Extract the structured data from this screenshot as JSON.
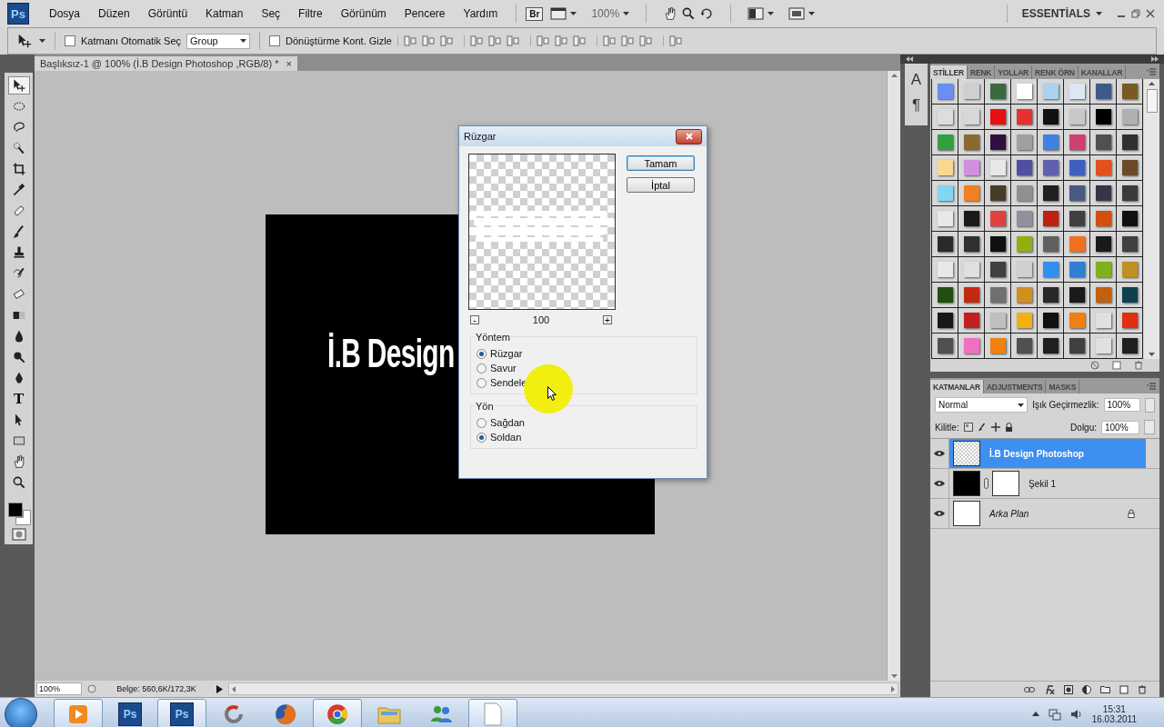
{
  "app": {
    "logo": "Ps",
    "menus": [
      "Dosya",
      "Düzen",
      "Görüntü",
      "Katman",
      "Seç",
      "Filtre",
      "Görünüm",
      "Pencere",
      "Yardım"
    ],
    "bridge": "Br",
    "zoom": "100%",
    "workspace": "ESSENTİALS"
  },
  "options": {
    "auto_select": {
      "label": "Katmanı Otomatik Seç",
      "checked": false
    },
    "auto_select_target": "Group",
    "transform_controls": {
      "label": "Dönüştürme Kont. Gizle",
      "checked": false
    }
  },
  "document": {
    "tab_title": "Başlıksız-1 @ 100% (İ.B Design Photoshop ,RGB/8) *",
    "close": "×",
    "canvas_text": "İ.B Design",
    "zoom": "100%",
    "doc_info": "Belge: 560,6K/172,3K"
  },
  "tools": [
    {
      "kind": "move",
      "selected": true
    },
    {
      "kind": "marquee",
      "selected": false
    },
    {
      "kind": "lasso",
      "selected": false
    },
    {
      "kind": "quick-select",
      "selected": false
    },
    {
      "kind": "crop",
      "selected": false
    },
    {
      "kind": "eyedropper",
      "selected": false
    },
    {
      "kind": "heal",
      "selected": false
    },
    {
      "kind": "brush",
      "selected": false
    },
    {
      "kind": "stamp",
      "selected": false
    },
    {
      "kind": "history-brush",
      "selected": false
    },
    {
      "kind": "eraser",
      "selected": false
    },
    {
      "kind": "gradient",
      "selected": false
    },
    {
      "kind": "blur",
      "selected": false
    },
    {
      "kind": "dodge",
      "selected": false
    },
    {
      "kind": "pen",
      "selected": false
    },
    {
      "kind": "type",
      "glyph": "T",
      "selected": false
    },
    {
      "kind": "path-select",
      "selected": false
    },
    {
      "kind": "shape",
      "selected": false
    },
    {
      "kind": "hand",
      "selected": false
    },
    {
      "kind": "zoom",
      "selected": false
    }
  ],
  "colors": {
    "foreground": {
      "color": "#000000"
    },
    "background": {
      "color": "#ffffff"
    }
  },
  "dialog": {
    "title": "Rüzgar",
    "zoom_out": "-",
    "preview_zoom": "100",
    "zoom_in": "+",
    "buttons": [
      {
        "label": "Tamam",
        "default": true
      },
      {
        "label": "İptal",
        "default": false
      }
    ],
    "groups": [
      {
        "title": "Yöntem",
        "options": [
          {
            "label": "Rüzgar",
            "selected": true
          },
          {
            "label": "Savur",
            "selected": false
          },
          {
            "label": "Sendele",
            "selected": false
          }
        ]
      },
      {
        "title": "Yön",
        "options": [
          {
            "label": "Sağdan",
            "selected": false
          },
          {
            "label": "Soldan",
            "selected": true
          }
        ]
      }
    ]
  },
  "dock": {
    "icons": [
      "A",
      "¶"
    ]
  },
  "styles_panel": {
    "tabs": [
      {
        "label": "STİLLER",
        "selected": true
      },
      {
        "label": "RENK",
        "selected": false
      },
      {
        "label": "YOLLAR",
        "selected": false
      },
      {
        "label": "RENK ÖRN",
        "selected": false
      },
      {
        "label": "KANALLAR",
        "selected": false
      }
    ],
    "rows": [
      {
        "swatches": [
          {
            "color": "#6b8ff0"
          },
          {
            "color": "#cfcfcf"
          },
          {
            "color": "#3a6a40"
          },
          {
            "color": "#ffffff"
          },
          {
            "color": "#a9d3f0"
          },
          {
            "color": "#dbe7f3"
          },
          {
            "color": "#3f5a88"
          },
          {
            "color": "#7a5a20"
          }
        ]
      },
      {
        "swatches": [
          {
            "color": "#dddddd"
          },
          {
            "color": "#d8d8d8"
          },
          {
            "color": "#e81010"
          },
          {
            "color": "#e83030"
          },
          {
            "color": "#111111"
          },
          {
            "color": "#c8c8c8"
          },
          {
            "color": "#000000"
          },
          {
            "color": "#b0b0b0"
          }
        ]
      },
      {
        "swatches": [
          {
            "color": "#30a040"
          },
          {
            "color": "#8a6a30"
          },
          {
            "color": "#301040"
          },
          {
            "color": "#a0a0a0"
          },
          {
            "color": "#4080e0"
          },
          {
            "color": "#d04070"
          },
          {
            "color": "#505050"
          },
          {
            "color": "#303030"
          }
        ]
      },
      {
        "swatches": [
          {
            "color": "#f8d890"
          },
          {
            "color": "#d090e0"
          },
          {
            "color": "#e8e8e8"
          },
          {
            "color": "#5050a0"
          },
          {
            "color": "#6060b0"
          },
          {
            "color": "#4060c0"
          },
          {
            "color": "#e05020"
          },
          {
            "color": "#6a4a2a"
          }
        ]
      },
      {
        "swatches": [
          {
            "color": "#80d8f0"
          },
          {
            "color": "#f08020"
          },
          {
            "color": "#4a3a2a"
          },
          {
            "color": "#909090"
          },
          {
            "color": "#202020"
          },
          {
            "color": "#4a5a80"
          },
          {
            "color": "#353545"
          },
          {
            "color": "#3a3a3a"
          }
        ]
      },
      {
        "swatches": [
          {
            "color": "#e8e8e8"
          },
          {
            "color": "#1a1a1a"
          },
          {
            "color": "#e04040"
          },
          {
            "color": "#9090a0"
          },
          {
            "color": "#c02010"
          },
          {
            "color": "#404040"
          },
          {
            "color": "#d05010"
          },
          {
            "color": "#101010"
          }
        ]
      },
      {
        "swatches": [
          {
            "color": "#2a2a2a"
          },
          {
            "color": "#303030"
          },
          {
            "color": "#101010"
          },
          {
            "color": "#90b010"
          },
          {
            "color": "#606060"
          },
          {
            "color": "#f07020"
          },
          {
            "color": "#1a1a1a"
          },
          {
            "color": "#404040"
          }
        ]
      },
      {
        "swatches": [
          {
            "color": "#e8e8e8"
          },
          {
            "color": "#e0e0e0"
          },
          {
            "color": "#404040"
          },
          {
            "color": "#d0d0d0"
          },
          {
            "color": "#3090f0"
          },
          {
            "color": "#3080d0"
          },
          {
            "color": "#80b020"
          },
          {
            "color": "#c09020"
          }
        ]
      },
      {
        "swatches": [
          {
            "color": "#205010"
          },
          {
            "color": "#c02a10"
          },
          {
            "color": "#707070"
          },
          {
            "color": "#d09020"
          },
          {
            "color": "#282828"
          },
          {
            "color": "#1a1a1a"
          },
          {
            "color": "#c06010"
          },
          {
            "color": "#104050"
          }
        ]
      },
      {
        "swatches": [
          {
            "color": "#181818"
          },
          {
            "color": "#c02020"
          },
          {
            "color": "#c0c0c0"
          },
          {
            "color": "#f0b010"
          },
          {
            "color": "#101010"
          },
          {
            "color": "#f08010"
          },
          {
            "color": "#e0e0e0"
          },
          {
            "color": "#e03010"
          }
        ]
      },
      {
        "swatches": [
          {
            "color": "#505050"
          },
          {
            "color": "#f070c0"
          },
          {
            "color": "#f08010"
          },
          {
            "color": "#505050"
          },
          {
            "color": "#202020"
          },
          {
            "color": "#404040"
          },
          {
            "color": "#e0e0e0"
          },
          {
            "color": "#202020"
          }
        ]
      }
    ]
  },
  "layers_panel": {
    "tabs": [
      {
        "label": "KATMANLAR",
        "selected": true
      },
      {
        "label": "ADJUSTMENTS",
        "selected": false
      },
      {
        "label": "MASKS",
        "selected": false
      }
    ],
    "blend_mode": "Normal",
    "opacity_label": "Işık Geçirmezlik:",
    "opacity": "100%",
    "lock_label": "Kilitle:",
    "fill_label": "Dolgu:",
    "fill": "100%",
    "layers": [
      {
        "name": "İ.B Design Photoshop",
        "kind": "text",
        "selected": true,
        "visible": true
      },
      {
        "name": "Şekil 1",
        "kind": "shape",
        "selected": false,
        "visible": true
      },
      {
        "name": "Arka Plan",
        "kind": "background",
        "selected": false,
        "visible": true
      }
    ]
  },
  "taskbar": {
    "items": [
      {
        "kind": "media",
        "active": true
      },
      {
        "kind": "photoshop",
        "label": "Ps",
        "active": false
      },
      {
        "kind": "photoshop",
        "label": "Ps",
        "active": true
      },
      {
        "kind": "ring",
        "active": false
      },
      {
        "kind": "fox",
        "active": false
      },
      {
        "kind": "browser",
        "active": true
      },
      {
        "kind": "folder",
        "active": false
      },
      {
        "kind": "people",
        "active": false
      },
      {
        "kind": "document",
        "active": true
      }
    ],
    "time": "15:31",
    "date": "16.03.2011"
  }
}
